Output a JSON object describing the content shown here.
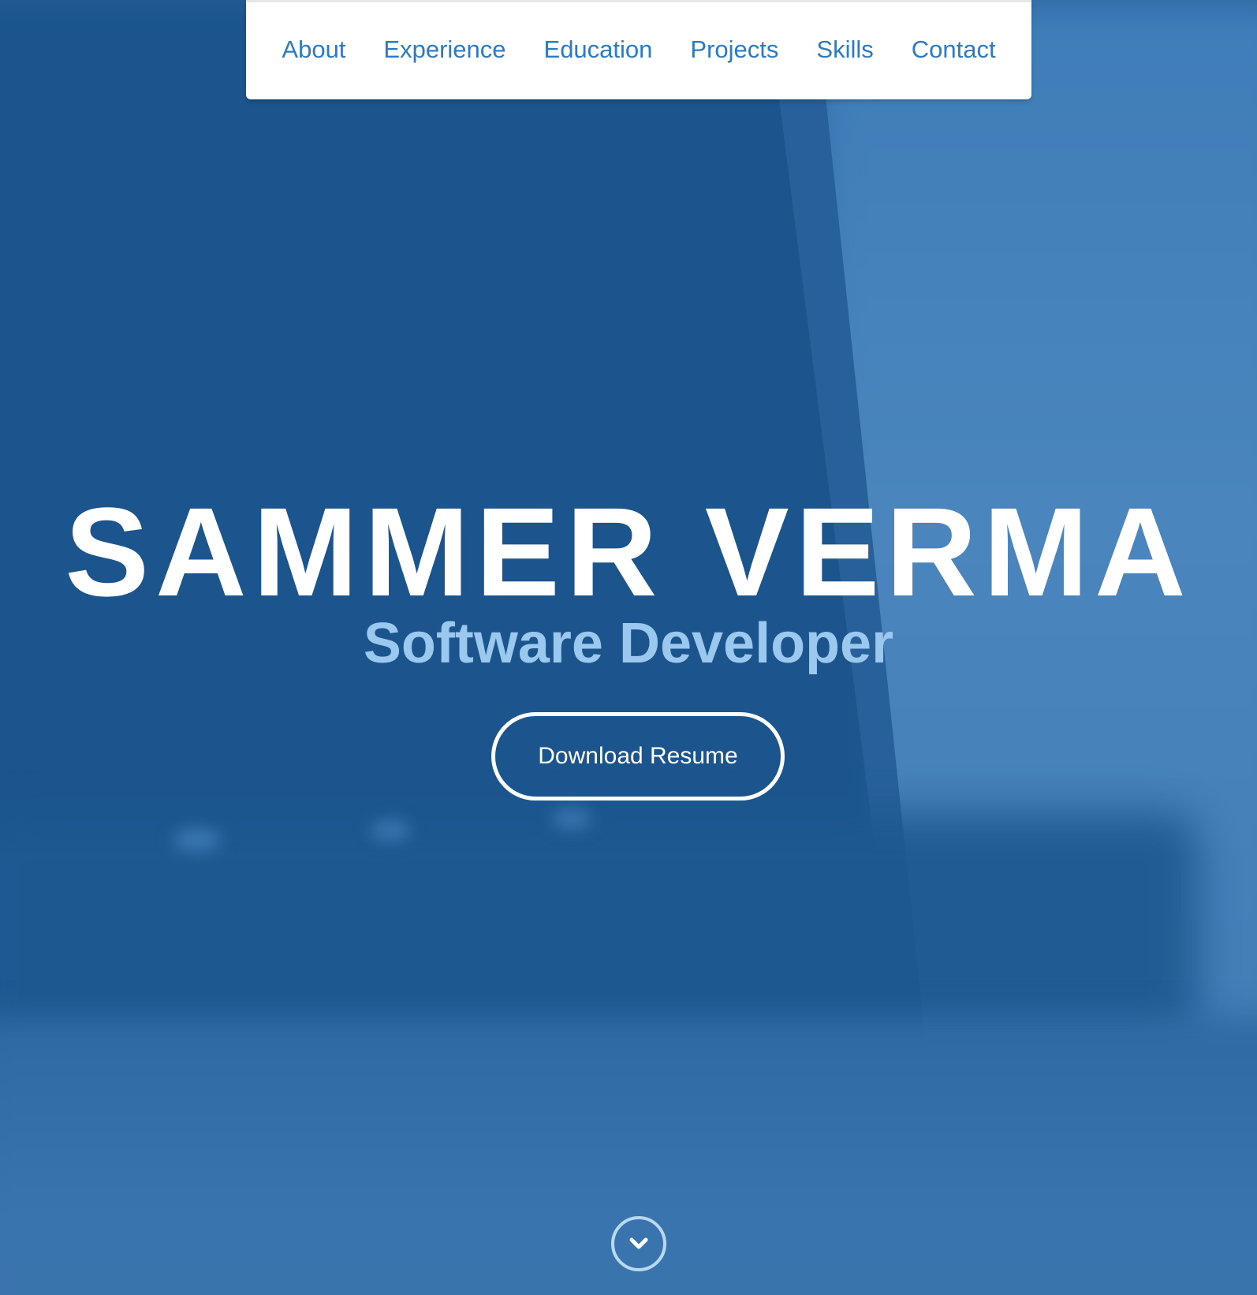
{
  "nav": {
    "items": [
      {
        "label": "About"
      },
      {
        "label": "Experience"
      },
      {
        "label": "Education"
      },
      {
        "label": "Projects"
      },
      {
        "label": "Skills"
      },
      {
        "label": "Contact"
      }
    ]
  },
  "hero": {
    "name": "SAMMER VERMA",
    "title": "Software Developer",
    "resume_button": "Download Resume",
    "scroll_icon": "chevron-down-circle-icon"
  },
  "colors": {
    "background": "#27609a",
    "nav_link": "#2b7bc4",
    "title_text": "#9ac8ee",
    "name_text": "#ffffff"
  }
}
